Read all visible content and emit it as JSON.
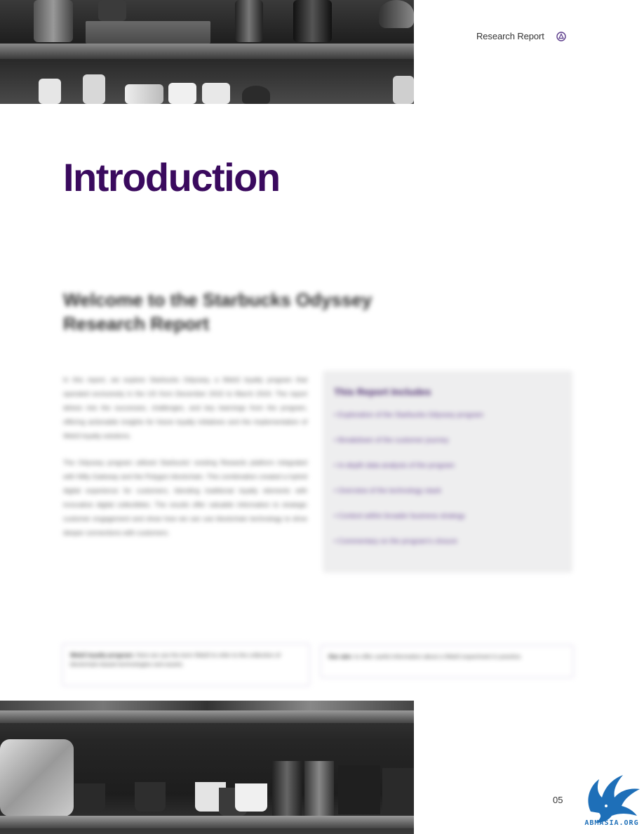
{
  "header": {
    "label": "Research Report",
    "logo_icon": "starbucks-siren-icon"
  },
  "title": "Introduction",
  "subheading": "Welcome to the Starbucks Odyssey Research Report",
  "body": {
    "paragraph_1": "In this report, we explore Starbucks Odyssey, a Web3 loyalty program that operated exclusively in the US from December 2022 to March 2024. The report delves into the successes, challenges, and key learnings from the program, offering actionable insights for future loyalty initiatives and the implementation of Web3 loyalty solutions.",
    "paragraph_2": "The Odyssey program utilized Starbucks' existing Rewards platform integrated with Nifty Gateway and the Polygon blockchain. This combination created a hybrid digital experience for customers, blending traditional loyalty elements with innovative digital collectibles. The results offer valuable information to strategic customer engagement and show how we can use blockchain technology to drive deeper connections with customers."
  },
  "report_box": {
    "heading": "This Report Includes",
    "items": [
      "Exploration of the Starbucks Odyssey program",
      "Breakdown of the customer journey",
      "In-depth data analysis of the program",
      "Overview of the technology stack",
      "Context within broader business strategy",
      "Commentary on the program's closure"
    ]
  },
  "notes": [
    {
      "bold": "Web3 loyalty program:",
      "text": "Here we use the term Web3 to refer to the collection of blockchain-based technologies and assets."
    },
    {
      "bold": "Our aim:",
      "text": "to offer useful information about a Web3 experiment in practice."
    }
  ],
  "page_number": "05",
  "corner_logo": {
    "icon": "eagle-logo-icon",
    "text": "ABMASIA.ORG",
    "color": "#1e6fb8"
  },
  "colors": {
    "title": "#3a0a5e",
    "accent": "#6b4a95",
    "box_background": "#eeeeef"
  }
}
